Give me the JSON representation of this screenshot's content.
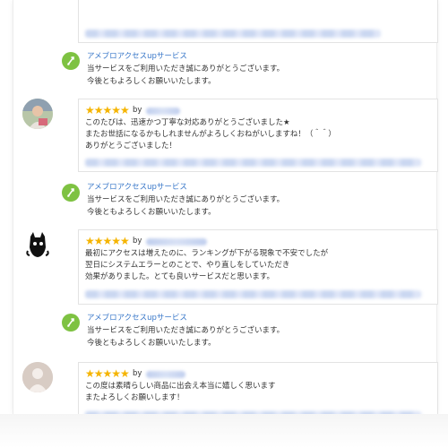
{
  "shop_name": "アメブロアクセスupサービス",
  "reply_text_1": "当サービスをご利用いただき誠にありがとうございます。",
  "reply_text_2": "今後ともよろしくお願いいたします。",
  "by_label": "by",
  "stars": "★★★★★",
  "reviews": [
    {
      "rating": 5,
      "lines": [
        "このたびは、迅速かつ丁寧な対応ありがとうございました★",
        "またお世話になるかもしれませんがよろしくおねがいしますね！（＾＾）",
        "ありがとうございました！"
      ]
    },
    {
      "rating": 5,
      "lines": [
        "最初にアクセスは増えたのに、ランキングが下がる現象で不安でしたが",
        "翌日にシステムエラーとのことで、やり直しをしていただき",
        "効果がありました。とても良いサービスだと思います。"
      ]
    },
    {
      "rating": 5,
      "lines": [
        "この度は素晴らしい商品に出会え本当に嬉しく思います",
        "またよろしくお願いします！"
      ]
    }
  ],
  "colors": {
    "star": "#f5b400",
    "shop_link": "#3a78c9",
    "reply_icon": "#7ec242"
  }
}
